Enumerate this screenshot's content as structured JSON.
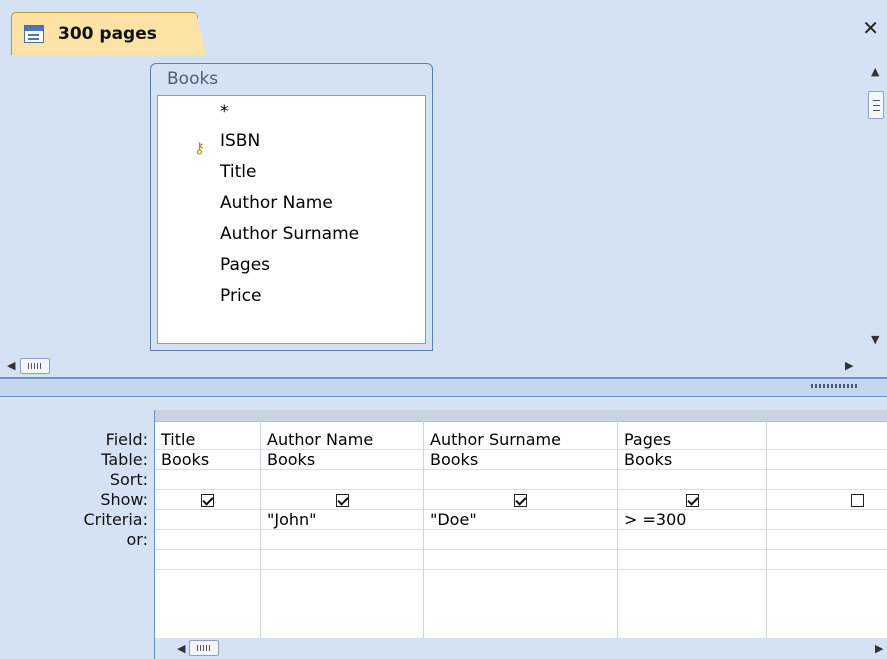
{
  "tab": {
    "title": "300 pages",
    "close": "✕"
  },
  "table": {
    "name": "Books",
    "fields": [
      "*",
      "ISBN",
      "Title",
      "Author Name",
      "Author Surname",
      "Pages",
      "Price"
    ]
  },
  "grid": {
    "row_labels": [
      "Field:",
      "Table:",
      "Sort:",
      "Show:",
      "Criteria:",
      "or:"
    ],
    "columns": [
      {
        "field": "Title",
        "table": "Books",
        "sort": "",
        "show": true,
        "criteria": "",
        "or": ""
      },
      {
        "field": "Author Name",
        "table": "Books",
        "sort": "",
        "show": true,
        "criteria": "\"John\"",
        "or": ""
      },
      {
        "field": "Author Surname",
        "table": "Books",
        "sort": "",
        "show": true,
        "criteria": "\"Doe\"",
        "or": ""
      },
      {
        "field": "Pages",
        "table": "Books",
        "sort": "",
        "show": true,
        "criteria": "> =300",
        "or": ""
      },
      {
        "field": "",
        "table": "",
        "sort": "",
        "show": false,
        "criteria": "",
        "or": ""
      }
    ]
  },
  "colors": {
    "pane": "#d5e2f4",
    "tab": "#fbe3a6",
    "border": "#6b8fc4"
  },
  "icons": {
    "tab": "query-icon",
    "key": "key-icon"
  }
}
